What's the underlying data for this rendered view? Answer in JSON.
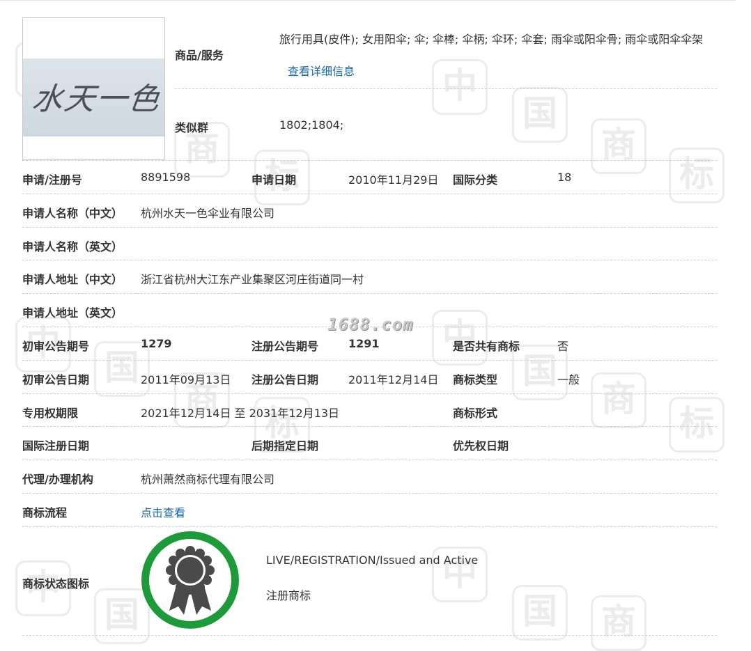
{
  "goods": {
    "label": "商品/服务",
    "value": "旅行用具(皮件); 女用阳伞; 伞; 伞棒; 伞柄; 伞环; 伞套; 雨伞或阳伞骨; 雨伞或阳伞伞架",
    "detail_link": "查看详细信息"
  },
  "similar_group": {
    "label": "类似群",
    "value": "1802;1804;"
  },
  "trademark_image": {
    "text": "水天一色"
  },
  "rows": {
    "reg_no": {
      "label": "申请/注册号",
      "value": "8891598"
    },
    "apply_date": {
      "label": "申请日期",
      "value": "2010年11月29日"
    },
    "intl_class": {
      "label": "国际分类",
      "value": "18"
    },
    "applicant_cn": {
      "label": "申请人名称（中文）",
      "value": "杭州水天一色伞业有限公司"
    },
    "applicant_en": {
      "label": "申请人名称（英文）",
      "value": ""
    },
    "address_cn": {
      "label": "申请人地址（中文）",
      "value": "浙江省杭州大江东产业集聚区河庄街道同一村"
    },
    "address_en": {
      "label": "申请人地址（英文）",
      "value": ""
    },
    "prelim_pub_no": {
      "label": "初审公告期号",
      "value": "1279"
    },
    "reg_pub_no": {
      "label": "注册公告期号",
      "value": "1291"
    },
    "shared": {
      "label": "是否共有商标",
      "value": "否"
    },
    "prelim_pub_date": {
      "label": "初审公告日期",
      "value": "2011年09月13日"
    },
    "reg_pub_date": {
      "label": "注册公告日期",
      "value": "2011年12月14日"
    },
    "tm_type": {
      "label": "商标类型",
      "value": "一般"
    },
    "exclusive_period": {
      "label": "专用权期限",
      "value": "2021年12月14日 至 2031年12月13日"
    },
    "tm_form": {
      "label": "商标形式",
      "value": ""
    },
    "intl_reg_date": {
      "label": "国际注册日期",
      "value": ""
    },
    "later_designation_date": {
      "label": "后期指定日期",
      "value": ""
    },
    "priority_date": {
      "label": "优先权日期",
      "value": ""
    },
    "agent": {
      "label": "代理/办理机构",
      "value": "杭州萧然商标代理有限公司"
    },
    "process": {
      "label": "商标流程",
      "link": "点击查看"
    }
  },
  "status": {
    "label": "商标状态图标",
    "en": "LIVE/REGISTRATION/Issued and Active",
    "cn": "注册商标"
  },
  "watermark": {
    "site": "1688.com"
  },
  "colors": {
    "link": "#1b6aa8",
    "badge_ring": "#1e9a3a",
    "badge_icon": "#4a4a4a"
  }
}
